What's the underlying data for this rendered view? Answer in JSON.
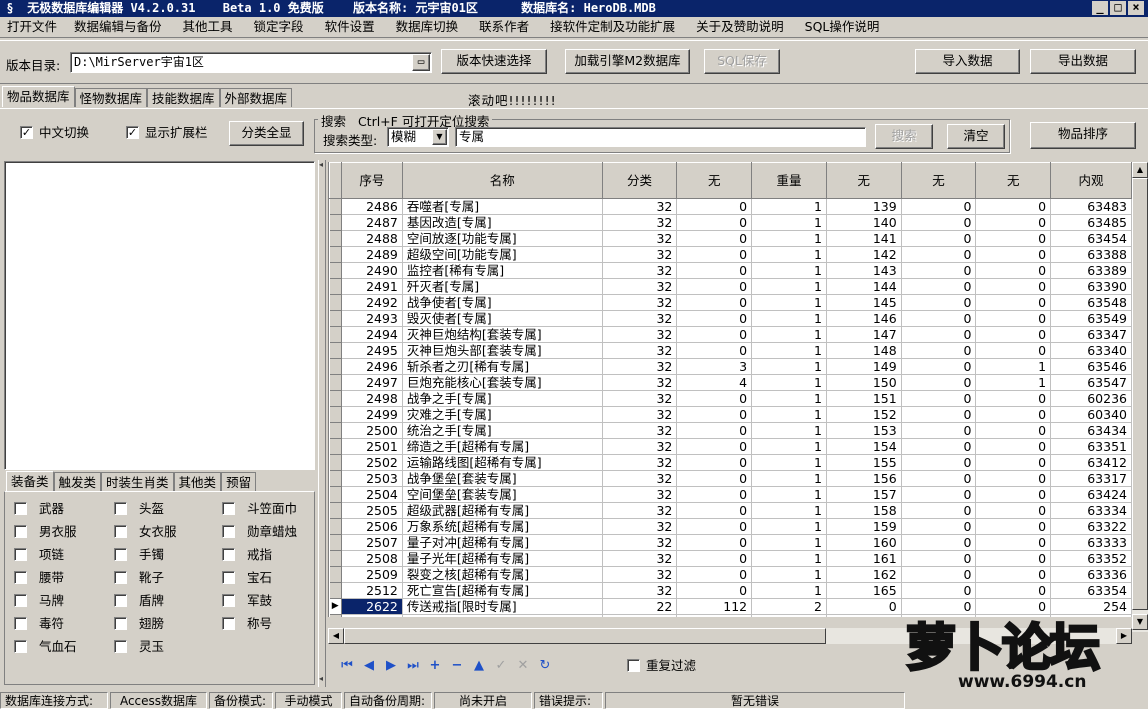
{
  "title": {
    "app": "无极数据库编辑器 V4.2.0.31",
    "edition": "Beta 1.0 免费版",
    "version_label": "版本名称:",
    "version": "元宇宙01区",
    "db_label": "数据库名:",
    "db": "HeroDB.MDB"
  },
  "window_controls": {
    "minimize": "_",
    "maximize": "□",
    "close": "×"
  },
  "menu": [
    "打开文件",
    "数据编辑与备份",
    "其他工具",
    "锁定字段",
    "软件设置",
    "数据库切换",
    "联系作者",
    "接软件定制及功能扩展",
    "关于及赞助说明",
    "SQL操作说明"
  ],
  "toolbar": {
    "dir_label": "版本目录:",
    "dir_value": "D:\\MirServer宇宙1区",
    "quick_select": "版本快速选择",
    "load_engine": "加载引擎M2数据库",
    "sql_save": "SQL保存",
    "import": "导入数据",
    "export": "导出数据"
  },
  "tabs": [
    "物品数据库",
    "怪物数据库",
    "技能数据库",
    "外部数据库"
  ],
  "scroll_text": "滚动吧!!!!!!!!",
  "options": {
    "chinese_switch": "中文切换",
    "show_ext": "显示扩展栏",
    "show_all": "分类全显"
  },
  "search": {
    "group_label": "搜索",
    "hint": "Ctrl+F 可打开定位搜索",
    "type_label": "搜索类型:",
    "type_value": "模糊",
    "query": "专属",
    "search_btn": "搜索",
    "clear_btn": "清空",
    "sort_btn": "物品排序"
  },
  "category_tabs": [
    "装备类",
    "触发类",
    "时装生肖类",
    "其他类",
    "预留"
  ],
  "categories": [
    [
      "武器",
      "头盔",
      "斗笠面巾"
    ],
    [
      "男衣服",
      "女衣服",
      "勋章蜡烛"
    ],
    [
      "项链",
      "手镯",
      "戒指"
    ],
    [
      "腰带",
      "靴子",
      "宝石"
    ],
    [
      "马牌",
      "盾牌",
      "军鼓"
    ],
    [
      "毒符",
      "翅膀",
      "称号"
    ],
    [
      "气血石",
      "灵玉",
      ""
    ]
  ],
  "grid": {
    "headers": [
      "序号",
      "名称",
      "分类",
      "无",
      "重量",
      "无",
      "无",
      "无",
      "内观"
    ],
    "rows": [
      [
        "2486",
        "吞噬者[专属]",
        "32",
        "0",
        "1",
        "139",
        "0",
        "0",
        "63483"
      ],
      [
        "2487",
        "基因改造[专属]",
        "32",
        "0",
        "1",
        "140",
        "0",
        "0",
        "63485"
      ],
      [
        "2488",
        "空间放逐[功能专属]",
        "32",
        "0",
        "1",
        "141",
        "0",
        "0",
        "63454"
      ],
      [
        "2489",
        "超级空间[功能专属]",
        "32",
        "0",
        "1",
        "142",
        "0",
        "0",
        "63388"
      ],
      [
        "2490",
        "监控者[稀有专属]",
        "32",
        "0",
        "1",
        "143",
        "0",
        "0",
        "63389"
      ],
      [
        "2491",
        "歼灭者[专属]",
        "32",
        "0",
        "1",
        "144",
        "0",
        "0",
        "63390"
      ],
      [
        "2492",
        "战争使者[专属]",
        "32",
        "0",
        "1",
        "145",
        "0",
        "0",
        "63548"
      ],
      [
        "2493",
        "毁灭使者[专属]",
        "32",
        "0",
        "1",
        "146",
        "0",
        "0",
        "63549"
      ],
      [
        "2494",
        "灭神巨炮结构[套装专属]",
        "32",
        "0",
        "1",
        "147",
        "0",
        "0",
        "63347"
      ],
      [
        "2495",
        "灭神巨炮头部[套装专属]",
        "32",
        "0",
        "1",
        "148",
        "0",
        "0",
        "63340"
      ],
      [
        "2496",
        "斩杀者之刃[稀有专属]",
        "32",
        "3",
        "1",
        "149",
        "0",
        "1",
        "63546"
      ],
      [
        "2497",
        "巨炮充能核心[套装专属]",
        "32",
        "4",
        "1",
        "150",
        "0",
        "1",
        "63547"
      ],
      [
        "2498",
        "战争之手[专属]",
        "32",
        "0",
        "1",
        "151",
        "0",
        "0",
        "60236"
      ],
      [
        "2499",
        "灾难之手[专属]",
        "32",
        "0",
        "1",
        "152",
        "0",
        "0",
        "60340"
      ],
      [
        "2500",
        "统治之手[专属]",
        "32",
        "0",
        "1",
        "153",
        "0",
        "0",
        "63434"
      ],
      [
        "2501",
        "缔造之手[超稀有专属]",
        "32",
        "0",
        "1",
        "154",
        "0",
        "0",
        "63351"
      ],
      [
        "2502",
        "运输路线图[超稀有专属]",
        "32",
        "0",
        "1",
        "155",
        "0",
        "0",
        "63412"
      ],
      [
        "2503",
        "战争堡垒[套装专属]",
        "32",
        "0",
        "1",
        "156",
        "0",
        "0",
        "63317"
      ],
      [
        "2504",
        "空间堡垒[套装专属]",
        "32",
        "0",
        "1",
        "157",
        "0",
        "0",
        "63424"
      ],
      [
        "2505",
        "超级武器[超稀有专属]",
        "32",
        "0",
        "1",
        "158",
        "0",
        "0",
        "63334"
      ],
      [
        "2506",
        "万象系统[超稀有专属]",
        "32",
        "0",
        "1",
        "159",
        "0",
        "0",
        "63322"
      ],
      [
        "2507",
        "量子对冲[超稀有专属]",
        "32",
        "0",
        "1",
        "160",
        "0",
        "0",
        "63333"
      ],
      [
        "2508",
        "量子光年[超稀有专属]",
        "32",
        "0",
        "1",
        "161",
        "0",
        "0",
        "63352"
      ],
      [
        "2509",
        "裂变之核[超稀有专属]",
        "32",
        "0",
        "1",
        "162",
        "0",
        "0",
        "63336"
      ],
      [
        "2512",
        "死亡宣告[超稀有专属]",
        "32",
        "0",
        "1",
        "165",
        "0",
        "0",
        "63354"
      ],
      [
        "2622",
        "传送戒指[限时专属]",
        "22",
        "112",
        "2",
        "0",
        "0",
        "0",
        "254"
      ]
    ]
  },
  "filter": {
    "dedupe": "重复过滤"
  },
  "status": {
    "conn_label": "数据库连接方式:",
    "conn_value": "Access数据库",
    "backup_label": "备份模式:",
    "backup_value": "手动模式",
    "auto_label": "自动备份周期:",
    "auto_value": "尚未开启",
    "err_label": "错误提示:",
    "err_value": "暂无错误"
  },
  "watermark": {
    "brand": "萝卜论坛",
    "url": "www.6994.cn"
  }
}
